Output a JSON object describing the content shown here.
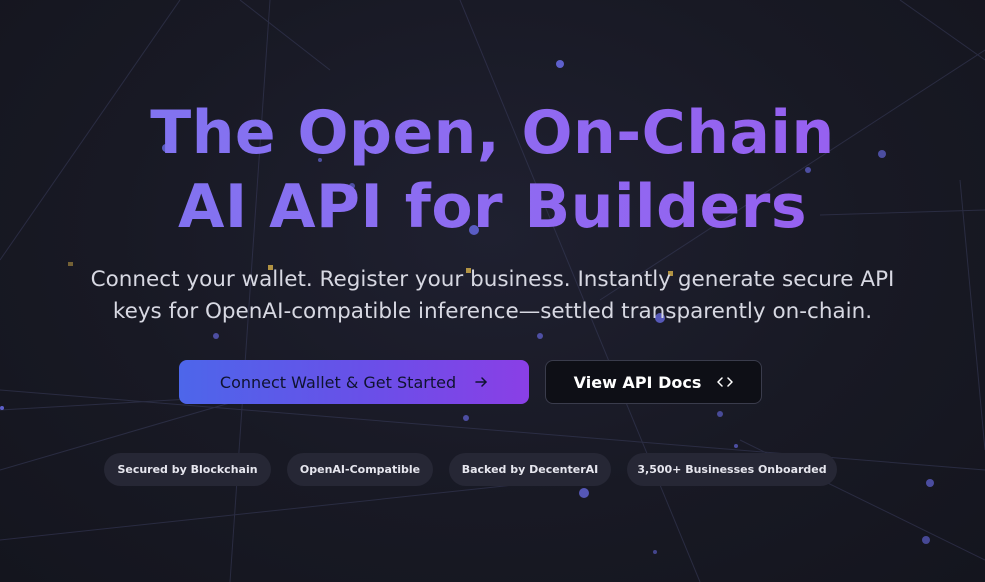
{
  "hero": {
    "headline_line1": "The Open, On-Chain",
    "headline_line2": "AI API for Builders",
    "subtitle_line1": "Connect your wallet. Register your business. Instantly generate secure API",
    "subtitle_line2": "keys for OpenAI-compatible inference—settled transparently on-chain."
  },
  "actions": {
    "primary_label": "Connect Wallet & Get Started",
    "primary_icon": "arrow-right-icon",
    "secondary_label": "View API Docs",
    "secondary_icon": "code-brackets-icon"
  },
  "badges": [
    "Secured by Blockchain",
    "OpenAI-Compatible",
    "Backed by DecenterAI",
    "3,500+ Businesses Onboarded"
  ],
  "colors": {
    "background": "#181924",
    "headline_gradient_start": "#7b77f0",
    "headline_gradient_end": "#9a5cf0",
    "primary_button_start": "#4d66ea",
    "primary_button_end": "#8a3fe6",
    "badge_background": "#262735",
    "node_glow": "#6f72f5",
    "node_gold": "#d8b14a"
  }
}
